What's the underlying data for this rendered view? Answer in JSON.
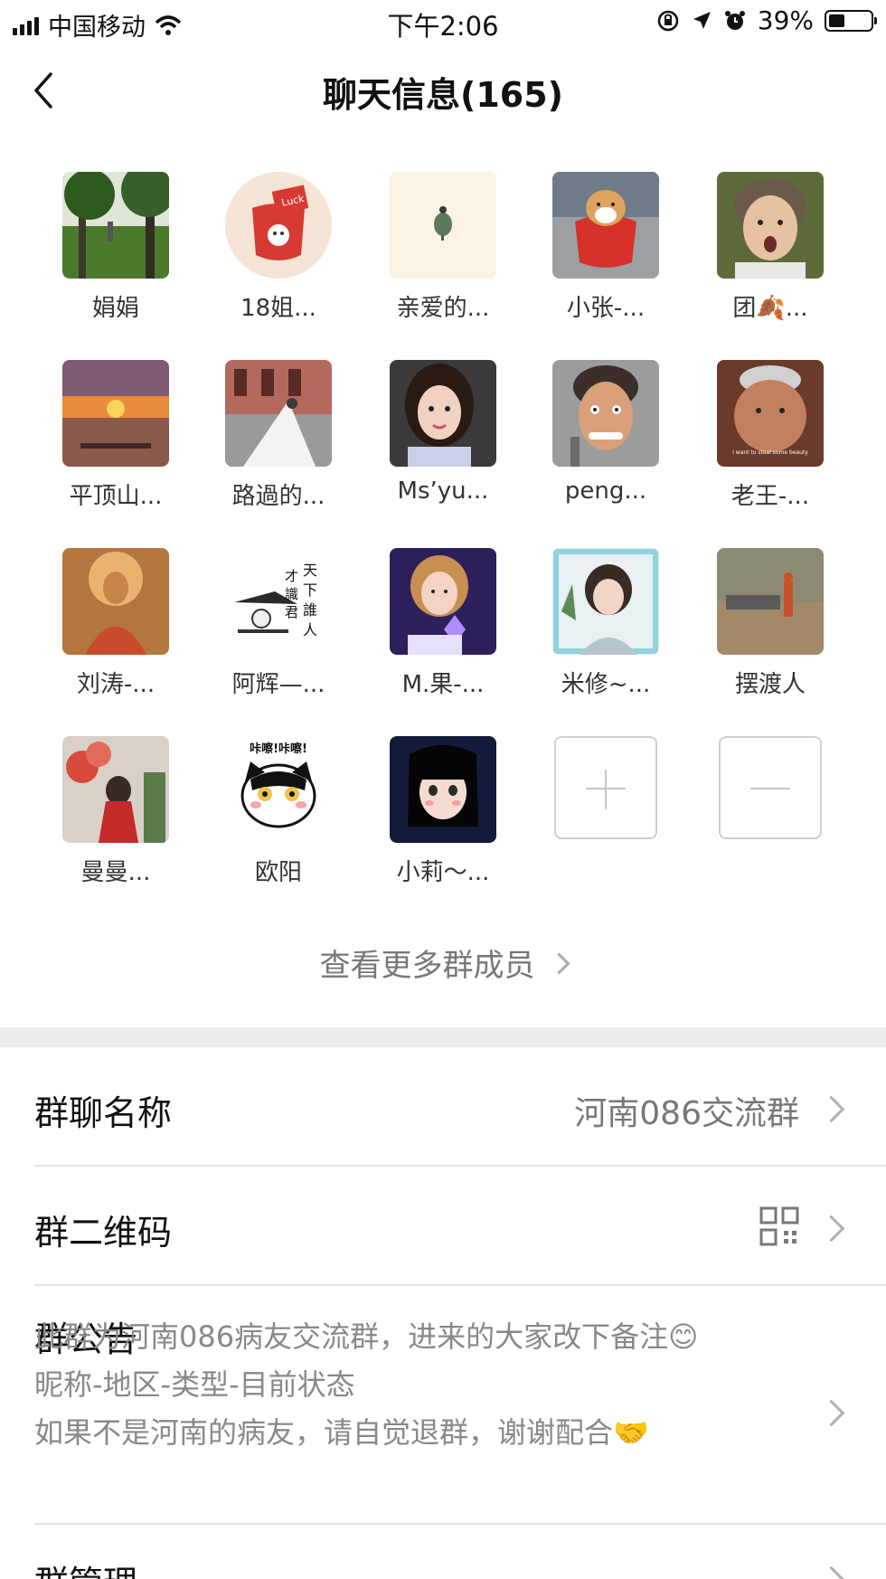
{
  "status_bar": {
    "carrier": "中国移动",
    "time": "下午2:06",
    "battery_percent": "39%",
    "battery_level": 0.39
  },
  "nav": {
    "title": "聊天信息(165)"
  },
  "members": [
    {
      "name": "娟娟",
      "avatar": "park-photo"
    },
    {
      "name": "18姐...",
      "avatar": "lucky-cartoon"
    },
    {
      "name": "亲爱的...",
      "avatar": "small-plant"
    },
    {
      "name": "小张-...",
      "avatar": "shiba-dog"
    },
    {
      "name": "团🍂...",
      "avatar": "man-portrait"
    },
    {
      "name": "平顶山...",
      "avatar": "sunset-boat"
    },
    {
      "name": "路過的...",
      "avatar": "wedding-photo"
    },
    {
      "name": "Ms’yu...",
      "avatar": "woman-selfie"
    },
    {
      "name": "peng...",
      "avatar": "caricature"
    },
    {
      "name": "老王-...",
      "avatar": "meme-face"
    },
    {
      "name": "刘涛-...",
      "avatar": "buddha"
    },
    {
      "name": "阿辉—...",
      "avatar": "calligraphy"
    },
    {
      "name": "M.果-...",
      "avatar": "girl-purple"
    },
    {
      "name": "米修~...",
      "avatar": "girl-shorthair"
    },
    {
      "name": "摆渡人",
      "avatar": "ferryman"
    },
    {
      "name": "曼曼...",
      "avatar": "balloons"
    },
    {
      "name": "欧阳",
      "avatar": "cat-sticker"
    },
    {
      "name": "小莉～...",
      "avatar": "anime-girl"
    }
  ],
  "calligraphy_text": "才識君天下誰人",
  "sticker_text": "咔嚓!咔嚓!",
  "lucky_text": "Luck",
  "meme_caption": "I want to steal some beauty",
  "actions": {
    "add_icon": "plus-icon",
    "remove_icon": "minus-icon"
  },
  "more_members_label": "查看更多群成员",
  "settings": {
    "group_name_label": "群聊名称",
    "group_name_value": "河南086交流群",
    "qr_label": "群二维码",
    "notice_label": "群公告",
    "notice_lines": [
      "此群为河南086病友交流群，进来的大家改下备注😊",
      "昵称-地区-类型-目前状态",
      "如果不是河南的病友，请自觉退群，谢谢配合🤝"
    ],
    "manage_label": "群管理"
  }
}
